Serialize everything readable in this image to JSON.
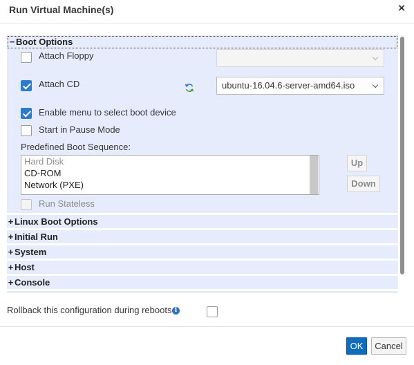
{
  "dialog": {
    "title": "Run Virtual Machine(s)",
    "close_glyph": "×"
  },
  "boot_options": {
    "header_label": "Boot Options",
    "expanded_sign": "−",
    "attach_floppy": {
      "label": "Attach Floppy",
      "checked": false,
      "select_value": ""
    },
    "attach_cd": {
      "label": "Attach CD",
      "checked": true,
      "select_value": "ubuntu-16.04.6-server-amd64.iso",
      "refresh_icon": "refresh-icon"
    },
    "enable_boot_menu": {
      "label": "Enable menu to select boot device",
      "checked": true
    },
    "start_paused": {
      "label": "Start in Pause Mode",
      "checked": false
    },
    "boot_sequence": {
      "label": "Predefined Boot Sequence:",
      "items": [
        "Hard Disk",
        "CD-ROM",
        "Network (PXE)"
      ],
      "up_label": "Up",
      "down_label": "Down"
    },
    "run_stateless": {
      "label": "Run Stateless",
      "checked": false
    }
  },
  "sections": [
    {
      "label": "Linux Boot Options",
      "sign": "+"
    },
    {
      "label": "Initial Run",
      "sign": "+"
    },
    {
      "label": "System",
      "sign": "+"
    },
    {
      "label": "Host",
      "sign": "+"
    },
    {
      "label": "Console",
      "sign": "+"
    }
  ],
  "rollback": {
    "label": "Rollback this configuration during reboots",
    "info_icon": "info-icon",
    "info_glyph": "i",
    "checked": false
  },
  "footer": {
    "ok_label": "OK",
    "cancel_label": "Cancel"
  },
  "colors": {
    "accent": "#0f6cbd",
    "panel_bg": "#e7ecfd",
    "checkbox_checked": "#2d7bc9"
  }
}
